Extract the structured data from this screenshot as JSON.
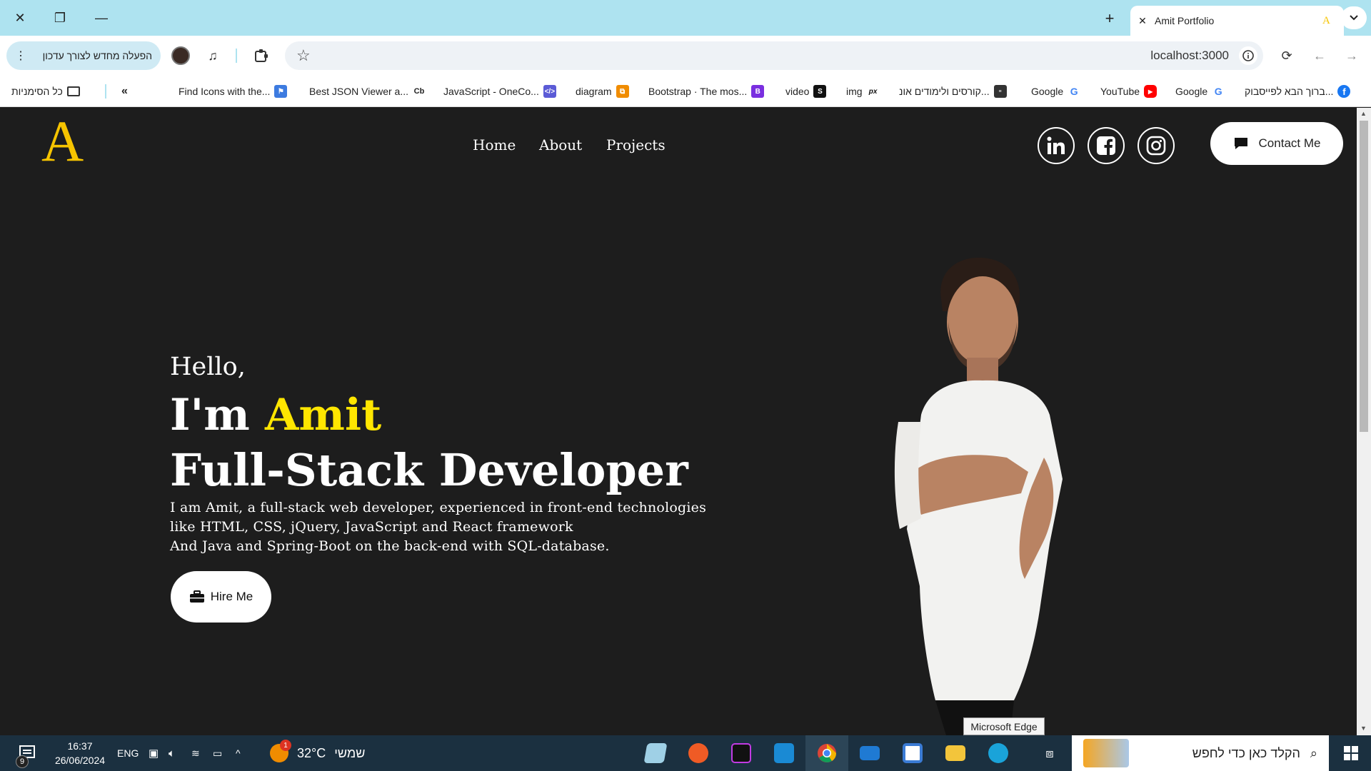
{
  "browser": {
    "tab_title": "Amit Portfolio",
    "tab_favicon": "A",
    "reactivate_label": "הפעלה מחדש לצורך עדכון",
    "url": "localhost:3000",
    "bookmarks": [
      {
        "label": "ברוך הבא לפייסבוק...",
        "icon": "facebook-icon"
      },
      {
        "label": "Google",
        "icon": "google-icon"
      },
      {
        "label": "YouTube",
        "icon": "youtube-icon"
      },
      {
        "label": "Google",
        "icon": "google-icon"
      },
      {
        "label": "קורסים ולימודים אונ...",
        "icon": "course-icon"
      },
      {
        "label": "img",
        "icon": "pexels-icon"
      },
      {
        "label": "video",
        "icon": "video-icon"
      },
      {
        "label": "Bootstrap · The mos...",
        "icon": "bootstrap-icon"
      },
      {
        "label": "diagram",
        "icon": "diagram-icon"
      },
      {
        "label": "JavaScript - OneCo...",
        "icon": "code-icon"
      },
      {
        "label": "Best JSON Viewer a...",
        "icon": "cb-icon"
      },
      {
        "label": "Find Icons with the...",
        "icon": "flag-icon"
      }
    ],
    "all_bookmarks_label": "כל הסימניות"
  },
  "page": {
    "logo": "A",
    "nav": [
      "Home",
      "About",
      "Projects"
    ],
    "contact_label": "Contact Me",
    "hello": "Hello,",
    "im_prefix": "I'm ",
    "name": "Amit",
    "role": "Full-Stack Developer",
    "intro": [
      "I am Amit, a full-stack web developer, experienced in front-end technologies",
      "like HTML, CSS, jQuery, JavaScript and React framework",
      "And Java and Spring-Boot on the back-end with SQL-database."
    ],
    "hire_label": "Hire Me",
    "tooltip": "Microsoft Edge"
  },
  "taskbar": {
    "search_placeholder": "הקלד כאן כדי לחפש",
    "weather_temp": "32°C",
    "weather_day": "שמשי",
    "weather_badge": "1",
    "lang": "ENG",
    "time": "16:37",
    "date": "26/06/2024",
    "notifications": "9"
  },
  "colors": {
    "accent": "#f6c400",
    "name_highlight": "#ffe600",
    "page_bg": "#1d1d1d"
  }
}
